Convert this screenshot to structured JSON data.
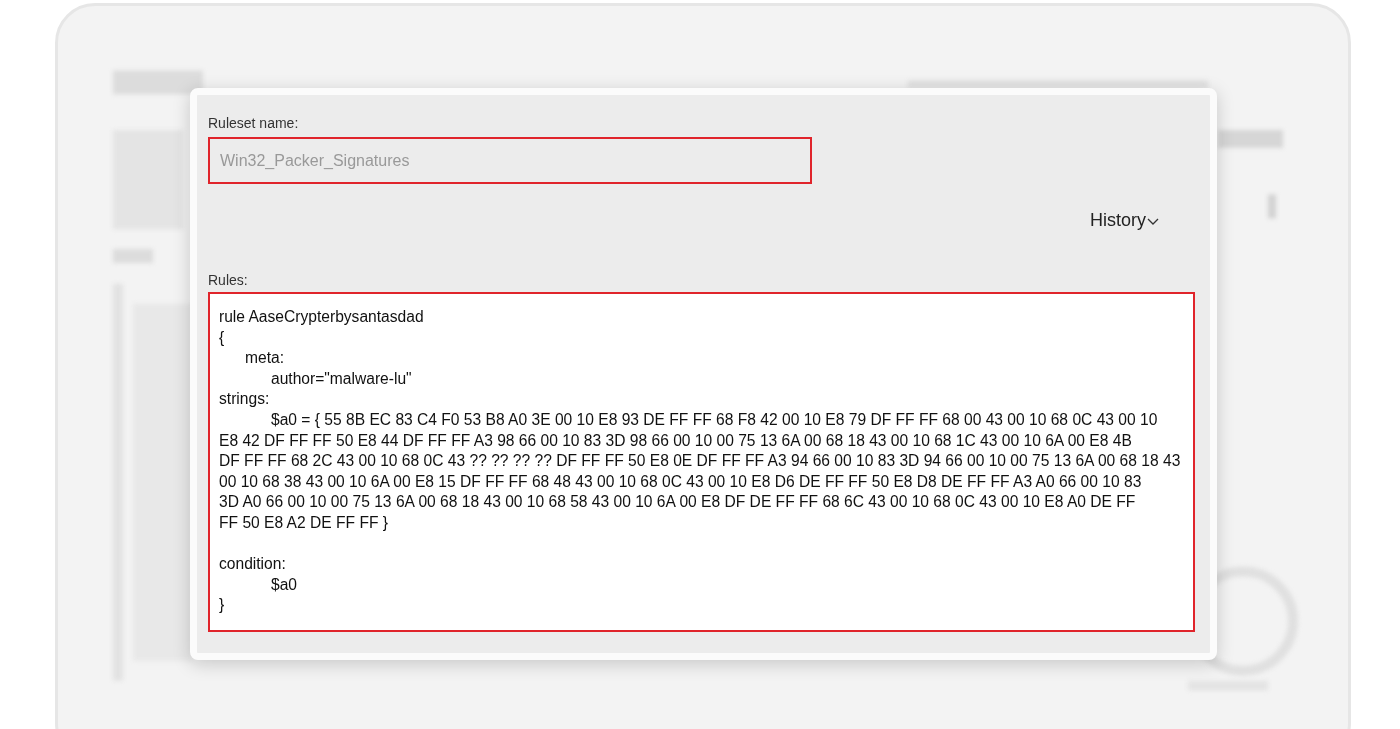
{
  "dialog": {
    "ruleset_name": {
      "label": "Ruleset name:",
      "value": "Win32_Packer_Signatures"
    },
    "history": {
      "label": "History"
    },
    "rules": {
      "label": "Rules:",
      "value": "rule AaseCrypterbysantasdad\n{\n      meta:\n            author=\"malware-lu\"\nstrings:\n            $a0 = { 55 8B EC 83 C4 F0 53 B8 A0 3E 00 10 E8 93 DE FF FF 68 F8 42 00 10 E8 79 DF FF FF 68 00 43 00 10 68 0C 43 00 10\nE8 42 DF FF FF 50 E8 44 DF FF FF A3 98 66 00 10 83 3D 98 66 00 10 00 75 13 6A 00 68 18 43 00 10 68 1C 43 00 10 6A 00 E8 4B\nDF FF FF 68 2C 43 00 10 68 0C 43 ?? ?? ?? ?? DF FF FF 50 E8 0E DF FF FF A3 94 66 00 10 83 3D 94 66 00 10 00 75 13 6A 00 68 18 43\n00 10 68 38 43 00 10 6A 00 E8 15 DF FF FF 68 48 43 00 10 68 0C 43 00 10 E8 D6 DE FF FF 50 E8 D8 DE FF FF A3 A0 66 00 10 83\n3D A0 66 00 10 00 75 13 6A 00 68 18 43 00 10 68 58 43 00 10 6A 00 E8 DF DE FF FF 68 6C 43 00 10 68 0C 43 00 10 E8 A0 DE FF\nFF 50 E8 A2 DE FF FF }\n\ncondition:\n            $a0\n}"
    }
  }
}
